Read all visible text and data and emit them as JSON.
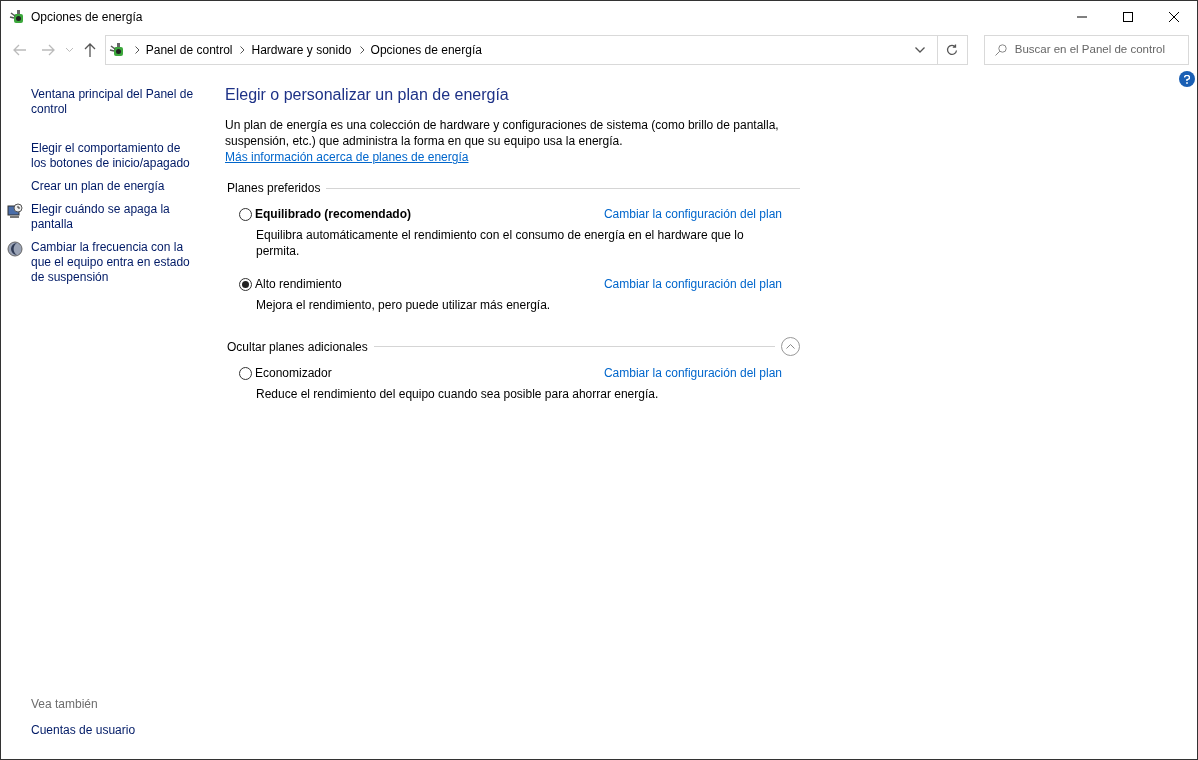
{
  "window": {
    "title": "Opciones de energía"
  },
  "address_bar": {
    "breadcrumbs": [
      "Panel de control",
      "Hardware y sonido",
      "Opciones de energía"
    ]
  },
  "search": {
    "placeholder": "Buscar en el Panel de control"
  },
  "sidebar": {
    "items": [
      {
        "label": "Ventana principal del Panel de control",
        "kind": "plain"
      },
      {
        "label": "Elegir el comportamiento de los botones de inicio/apagado",
        "kind": "plain"
      },
      {
        "label": "Crear un plan de energía",
        "kind": "plain"
      },
      {
        "label": "Elegir cuándo se apaga la pantalla",
        "kind": "monitor"
      },
      {
        "label": "Cambiar la frecuencia con la que el equipo entra en estado de suspensión",
        "kind": "moon"
      }
    ],
    "see_also": {
      "heading": "Vea también",
      "links": [
        "Cuentas de usuario"
      ]
    }
  },
  "main": {
    "title": "Elegir o personalizar un plan de energía",
    "intro": "Un plan de energía es una colección de hardware y configuraciones de sistema (como brillo de pantalla, suspensión, etc.) que administra la forma en que su equipo usa la energía.",
    "intro_link": "Más información acerca de planes de energía",
    "groups": [
      {
        "heading": "Planes preferidos",
        "collapse_toggle": false,
        "plans": [
          {
            "name": "Equilibrado (recomendado)",
            "bold": true,
            "selected": false,
            "description": "Equilibra automáticamente el rendimiento con el consumo de energía en el hardware que lo permita.",
            "link": "Cambiar la configuración del plan"
          },
          {
            "name": "Alto rendimiento",
            "bold": false,
            "selected": true,
            "description": "Mejora el rendimiento, pero puede utilizar más energía.",
            "link": "Cambiar la configuración del plan"
          }
        ]
      },
      {
        "heading": "Ocultar planes adicionales",
        "collapse_toggle": true,
        "plans": [
          {
            "name": "Economizador",
            "bold": false,
            "selected": false,
            "description": "Reduce el rendimiento del equipo cuando sea posible para ahorrar energía.",
            "link": "Cambiar la configuración del plan"
          }
        ]
      }
    ]
  }
}
